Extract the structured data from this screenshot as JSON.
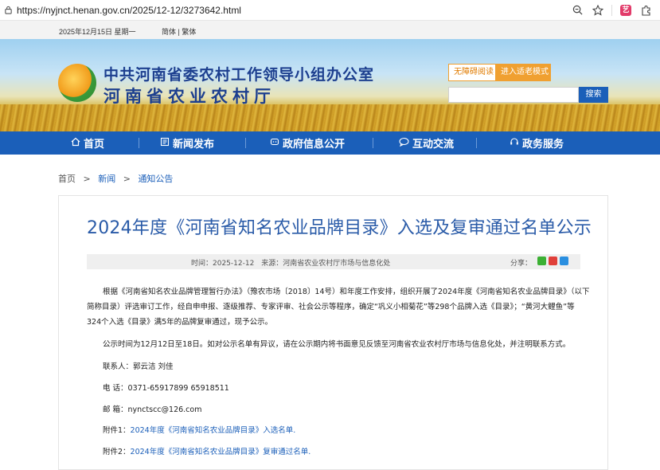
{
  "browser": {
    "url": "https://nyjnct.henan.gov.cn/2025/12-12/3273642.html",
    "icons": [
      "lock-icon",
      "zoom-icon",
      "star-icon",
      "extension-icon",
      "puzzle-icon"
    ]
  },
  "topbar": {
    "date": "2025年12月15日 星期一",
    "lang": "简体 | 繁体"
  },
  "header": {
    "title_line1": "中共河南省委农村工作领导小组办公室",
    "title_line2": "河南省农业农村厅",
    "accessible_btn": "无障碍阅读",
    "elder_btn": "进入适老模式",
    "search_placeholder": "",
    "search_btn": "搜索"
  },
  "nav": {
    "items": [
      {
        "label": "首页",
        "icon": "home-icon"
      },
      {
        "label": "新闻发布",
        "icon": "news-icon"
      },
      {
        "label": "政府信息公开",
        "icon": "gov-info-icon"
      },
      {
        "label": "互动交流",
        "icon": "chat-icon"
      },
      {
        "label": "政务服务",
        "icon": "service-icon"
      }
    ]
  },
  "breadcrumb": [
    "首页",
    ">",
    "新闻",
    ">",
    "通知公告"
  ],
  "article": {
    "title": "2024年度《河南省知名农业品牌目录》入选及复审通过名单公示",
    "meta": "时间：2025-12-12　来源：河南省农业农村厅市场与信息化处",
    "share_label": "分享：",
    "paragraphs": [
      "根据《河南省知名农业品牌管理暂行办法》（豫农市场〔2018〕14号）和年度工作安排，组织开展了2024年度《河南省知名农业品牌目录》（以下",
      "简称目录）评选审订工作，经自申申报、逐级推荐、专家评审、社会公示等程序，确定“巩义小相菊花”等298个品牌入选《目录》；“黄河大鲤鱼”等",
      "324个入选《目录》满5年的品牌复审通过，现予公示。",
      "公示时间为12月12日至18日。如对公示名单有异议，请在公示期内将书面意见反馈至河南省农业农村厅市场与信息化处，并注明联系方式。",
      "联系人：郭云洁 刘佳",
      "电 话：0371-65917899 65918511",
      "邮 箱：nynctscc@126.com"
    ],
    "attachments": [
      {
        "label": "附件1：",
        "text": "2024年度《河南省知名农业品牌目录》入选名单."
      },
      {
        "label": "附件2：",
        "text": "2024年度《河南省知名农业品牌目录》复审通过名单."
      }
    ]
  }
}
